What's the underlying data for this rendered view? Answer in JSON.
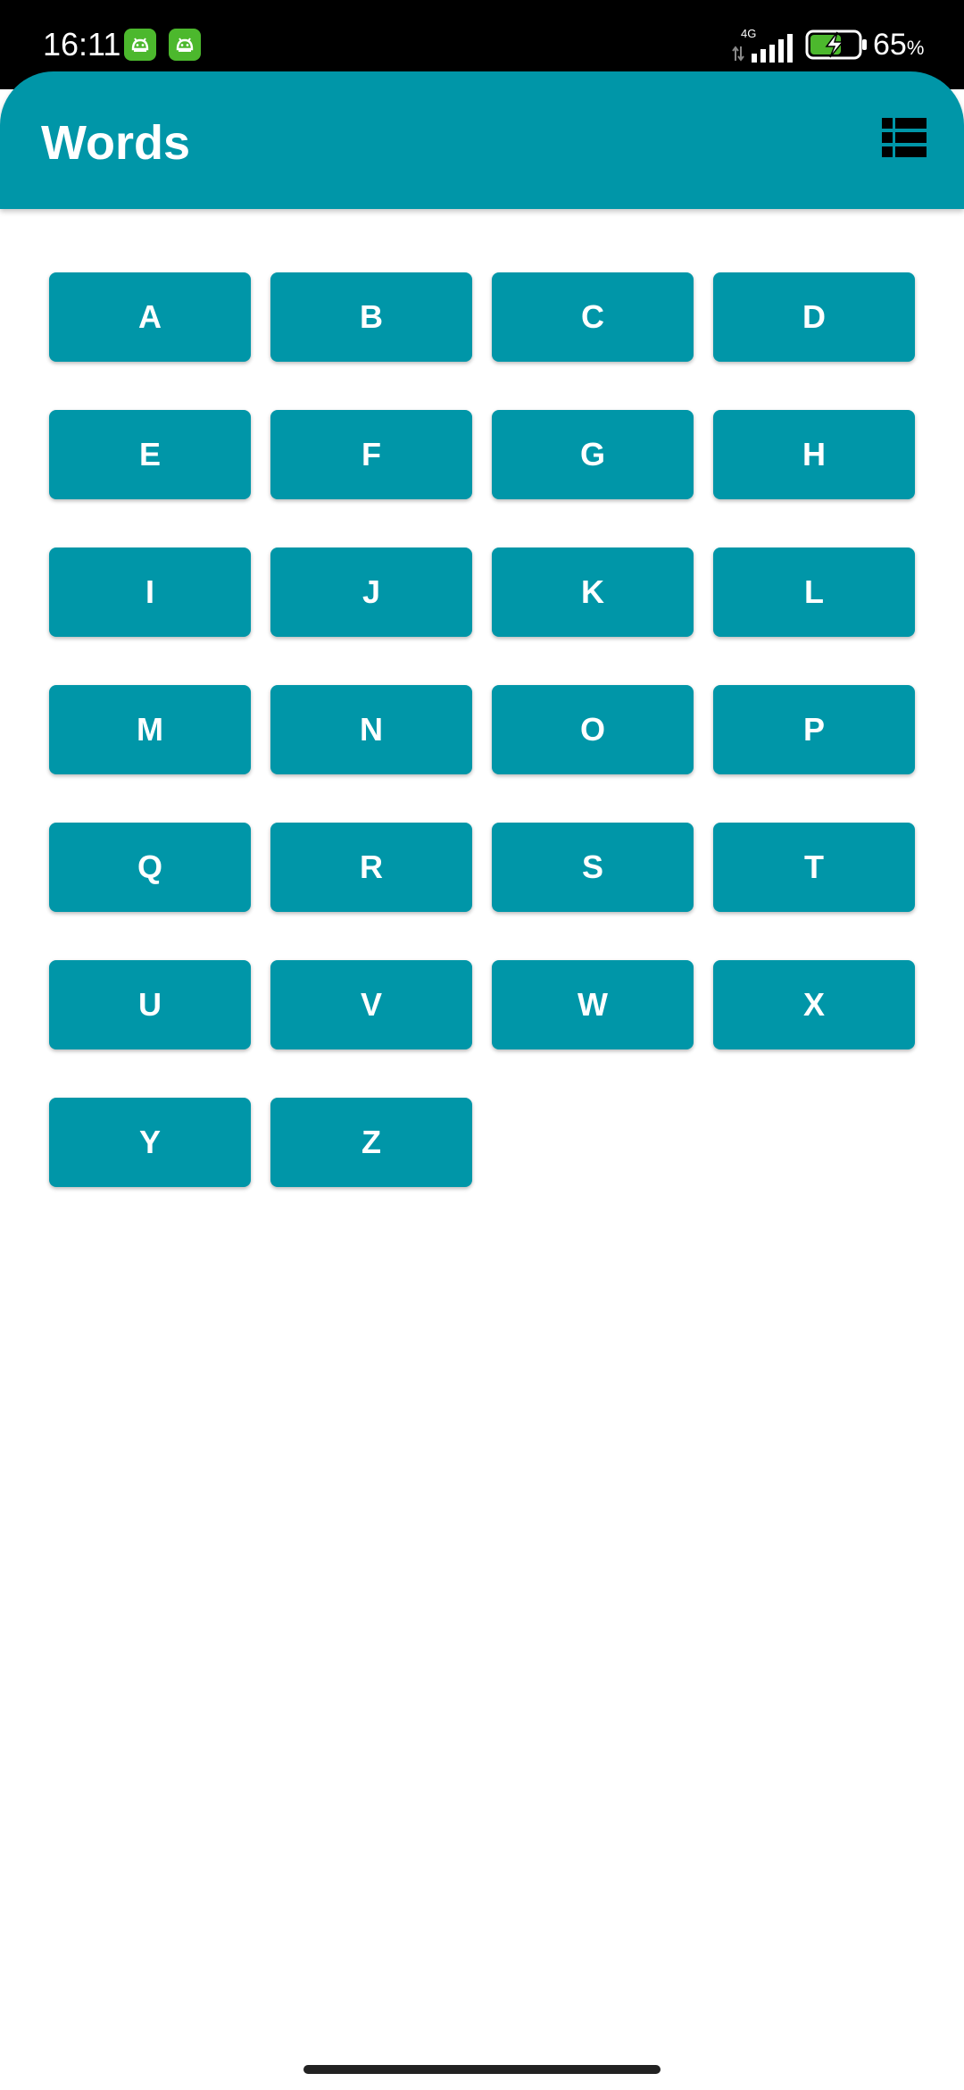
{
  "status_bar": {
    "time": "16:11",
    "network_type": "4G",
    "battery_percent": "65",
    "battery_percent_sign": "%",
    "battery_level": 0.65,
    "battery_charging": true,
    "notification_icons": [
      "android-app-icon",
      "android-app-icon"
    ]
  },
  "app_bar": {
    "title": "Words",
    "layout_toggle_icon": "list-view-icon"
  },
  "letters": [
    "A",
    "B",
    "C",
    "D",
    "E",
    "F",
    "G",
    "H",
    "I",
    "J",
    "K",
    "L",
    "M",
    "N",
    "O",
    "P",
    "Q",
    "R",
    "S",
    "T",
    "U",
    "V",
    "W",
    "X",
    "Y",
    "Z"
  ],
  "colors": {
    "primary": "#0096A8",
    "on_primary": "#FFFFFF",
    "background": "#FFFFFF",
    "status_bar": "#000000",
    "battery_charge": "#4CB82D"
  }
}
